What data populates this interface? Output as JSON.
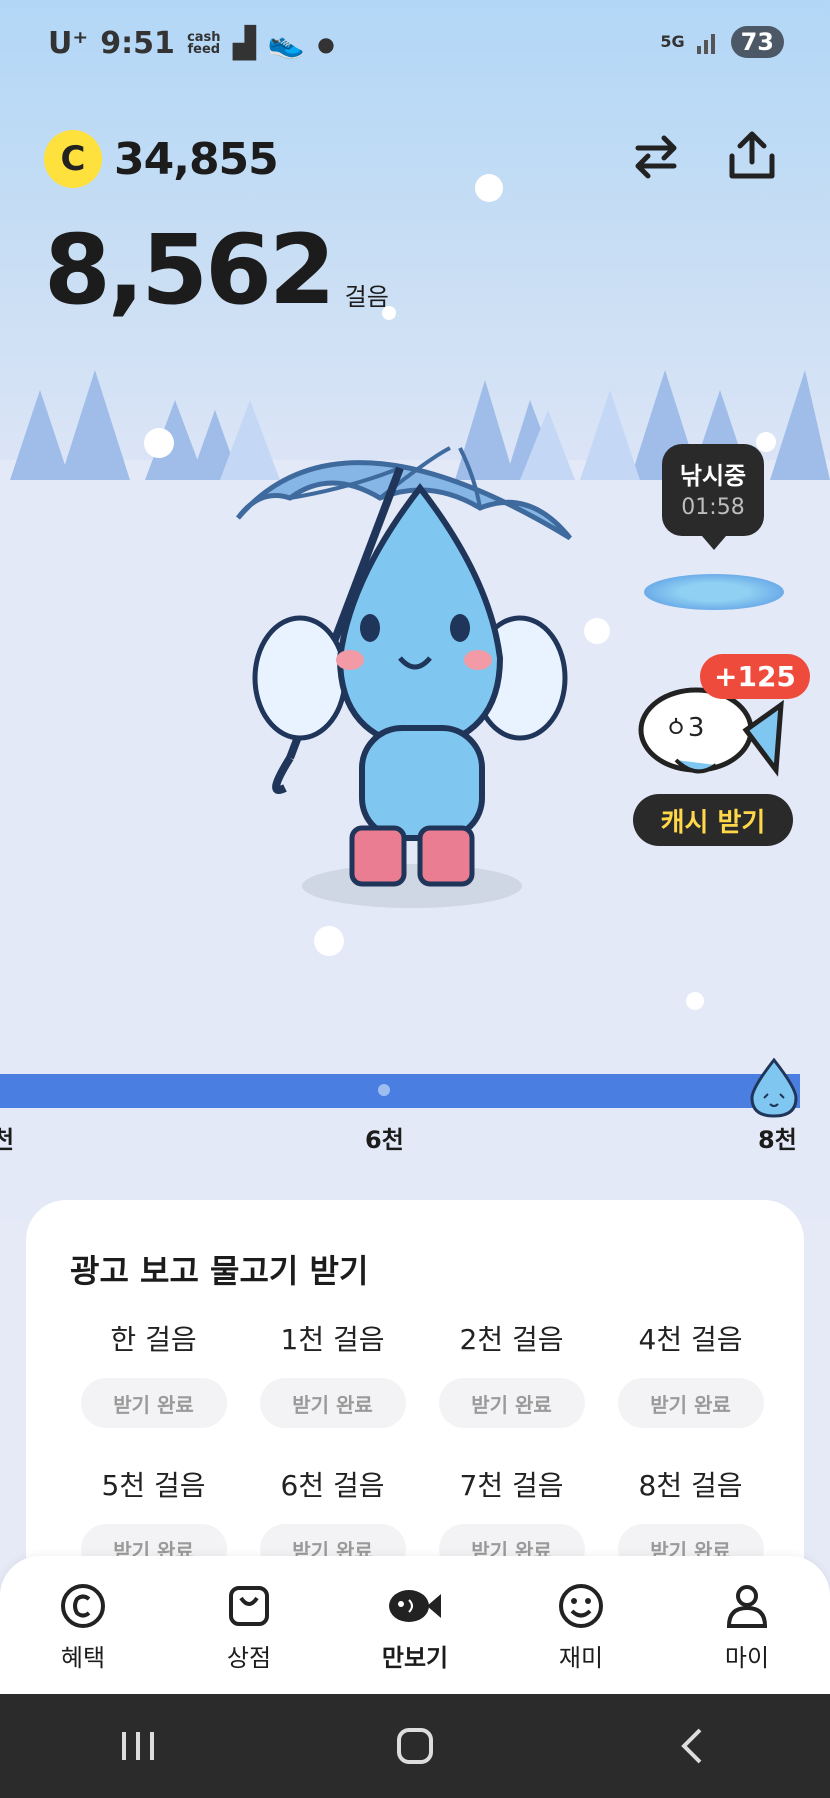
{
  "status_bar": {
    "carrier": "U⁺",
    "time": "9:51",
    "cashfeed_label": "cash feed",
    "network": "5G",
    "battery": "73"
  },
  "header": {
    "cash_balance": "34,855",
    "coin_symbol": "C",
    "step_count": "8,562",
    "step_unit": "걸음"
  },
  "fishing": {
    "status_label": "낚시중",
    "timer": "01:58",
    "reward_badge": "+125",
    "claim_button": "캐시 받기"
  },
  "progress": {
    "label_left": "천",
    "label_mid": "6천",
    "label_right": "8천"
  },
  "ad_card": {
    "title": "광고 보고 물고기 받기",
    "items": [
      {
        "label": "한 걸음",
        "status": "받기 완료"
      },
      {
        "label": "1천 걸음",
        "status": "받기 완료"
      },
      {
        "label": "2천 걸음",
        "status": "받기 완료"
      },
      {
        "label": "4천 걸음",
        "status": "받기 완료"
      },
      {
        "label": "5천 걸음",
        "status": "받기 완료"
      },
      {
        "label": "6천 걸음",
        "status": "받기 완료"
      },
      {
        "label": "7천 걸음",
        "status": "받기 완료"
      },
      {
        "label": "8천 걸음",
        "status": "받기 완료"
      }
    ]
  },
  "tabs": [
    {
      "label": "혜택",
      "icon": "coin-circle-icon"
    },
    {
      "label": "상점",
      "icon": "shopping-bag-icon"
    },
    {
      "label": "만보기",
      "icon": "fish-icon",
      "active": true
    },
    {
      "label": "재미",
      "icon": "smile-icon"
    },
    {
      "label": "마이",
      "icon": "person-icon"
    }
  ],
  "colors": {
    "accent_blue": "#4a7ee0",
    "coin_yellow": "#ffe13d",
    "badge_red": "#ef4b3d"
  }
}
